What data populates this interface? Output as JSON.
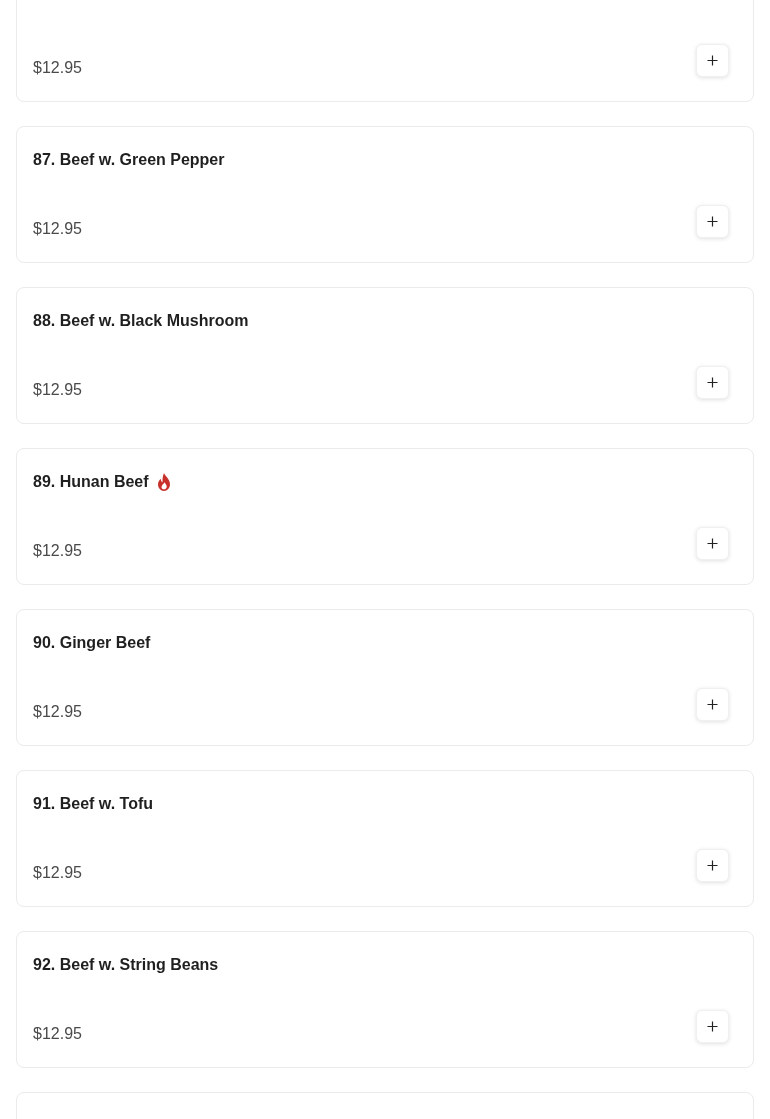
{
  "menu_items": [
    {
      "kind": "item",
      "price": "$12.95"
    },
    {
      "kind": "item",
      "name": "87. Beef w. Green Pepper",
      "spicy": false,
      "price": "$12.95"
    },
    {
      "kind": "item",
      "name": "88. Beef w. Black Mushroom",
      "spicy": false,
      "price": "$12.95"
    },
    {
      "kind": "item",
      "name": "89. Hunan Beef",
      "spicy": true,
      "price": "$12.95"
    },
    {
      "kind": "item",
      "name": "90. Ginger Beef",
      "spicy": false,
      "price": "$12.95"
    },
    {
      "kind": "item",
      "name": "91. Beef w. Tofu",
      "spicy": false,
      "price": "$12.95"
    },
    {
      "kind": "item",
      "name": "92. Beef w. String Beans",
      "spicy": false,
      "price": "$12.95"
    },
    {
      "kind": "clipped"
    }
  ]
}
